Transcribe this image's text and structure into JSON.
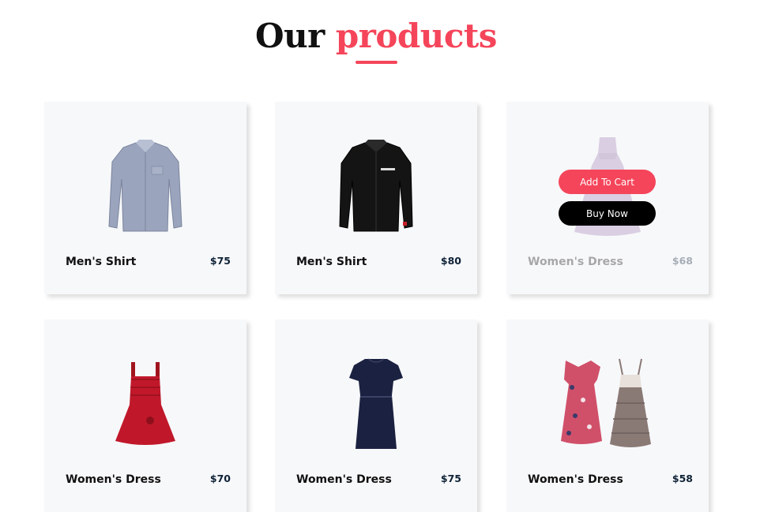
{
  "section": {
    "title_prefix": "Our",
    "title_accent": "products",
    "accent_color": "#f5455a"
  },
  "products": [
    {
      "name": "Men's Shirt",
      "price": "$75",
      "image": "light-blue-shirt"
    },
    {
      "name": "Men's Shirt",
      "price": "$80",
      "image": "black-shirt"
    },
    {
      "name": "Women's Dress",
      "price": "$68",
      "image": "lilac-dress"
    },
    {
      "name": "Women's Dress",
      "price": "$70",
      "image": "red-dress"
    },
    {
      "name": "Women's Dress",
      "price": "$75",
      "image": "navy-dress"
    },
    {
      "name": "Women's Dress",
      "price": "$58",
      "image": "floral-and-grey-dresses"
    }
  ],
  "hover_actions": {
    "add_to_cart": "Add To Cart",
    "buy_now": "Buy Now"
  }
}
